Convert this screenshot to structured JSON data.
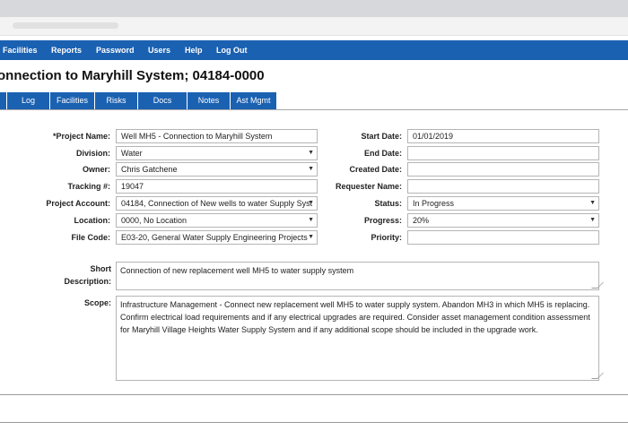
{
  "nav": {
    "items": [
      "Facilities",
      "Reports",
      "Password",
      "Users",
      "Help",
      "Log Out"
    ]
  },
  "page": {
    "title": "onnection to Maryhill System; 04184-0000"
  },
  "tabs": [
    "Log",
    "Facilities",
    "Risks",
    "Docs",
    "Notes",
    "Ast Mgmt"
  ],
  "form": {
    "project_name": {
      "label": "*Project Name:",
      "value": "Well MH5 - Connection to Maryhill System"
    },
    "division": {
      "label": "Division:",
      "value": "Water"
    },
    "owner": {
      "label": "Owner:",
      "value": "Chris Gatchene"
    },
    "tracking": {
      "label": "Tracking #:",
      "value": "19047"
    },
    "project_account": {
      "label": "Project Account:",
      "value": "04184, Connection of New wells to water Supply Syst"
    },
    "location": {
      "label": "Location:",
      "value": "0000, No Location"
    },
    "file_code": {
      "label": "File Code:",
      "value": "E03-20, General Water Supply Engineering Projects"
    },
    "start_date": {
      "label": "Start Date:",
      "value": "01/01/2019"
    },
    "end_date": {
      "label": "End Date:",
      "value": ""
    },
    "created_date": {
      "label": "Created Date:",
      "value": ""
    },
    "requester_name": {
      "label": "Requester Name:",
      "value": ""
    },
    "status": {
      "label": "Status:",
      "value": "In Progress"
    },
    "progress": {
      "label": "Progress:",
      "value": "20%"
    },
    "priority": {
      "label": "Priority:",
      "value": ""
    },
    "short_description": {
      "label_line1": "Short",
      "label_line2": "Description:",
      "value": "Connection of new replacement well MH5 to water supply system"
    },
    "scope": {
      "label": "Scope:",
      "value": "Infrastructure Management - Connect new replacement well MH5 to water supply system.  Abandon MH3 in which MH5 is replacing.  Confirm electrical load requirements and if any electrical upgrades are required.  Consider asset management condition assessment for Maryhill Village Heights Water Supply System and if any additional scope should be included in the upgrade work."
    }
  },
  "icons": {
    "dropdown": "caret-down-icon",
    "resize": "resize-grip-icon"
  },
  "colors": {
    "nav_bg": "#1b61b2",
    "nav_text": "#ffffff"
  }
}
